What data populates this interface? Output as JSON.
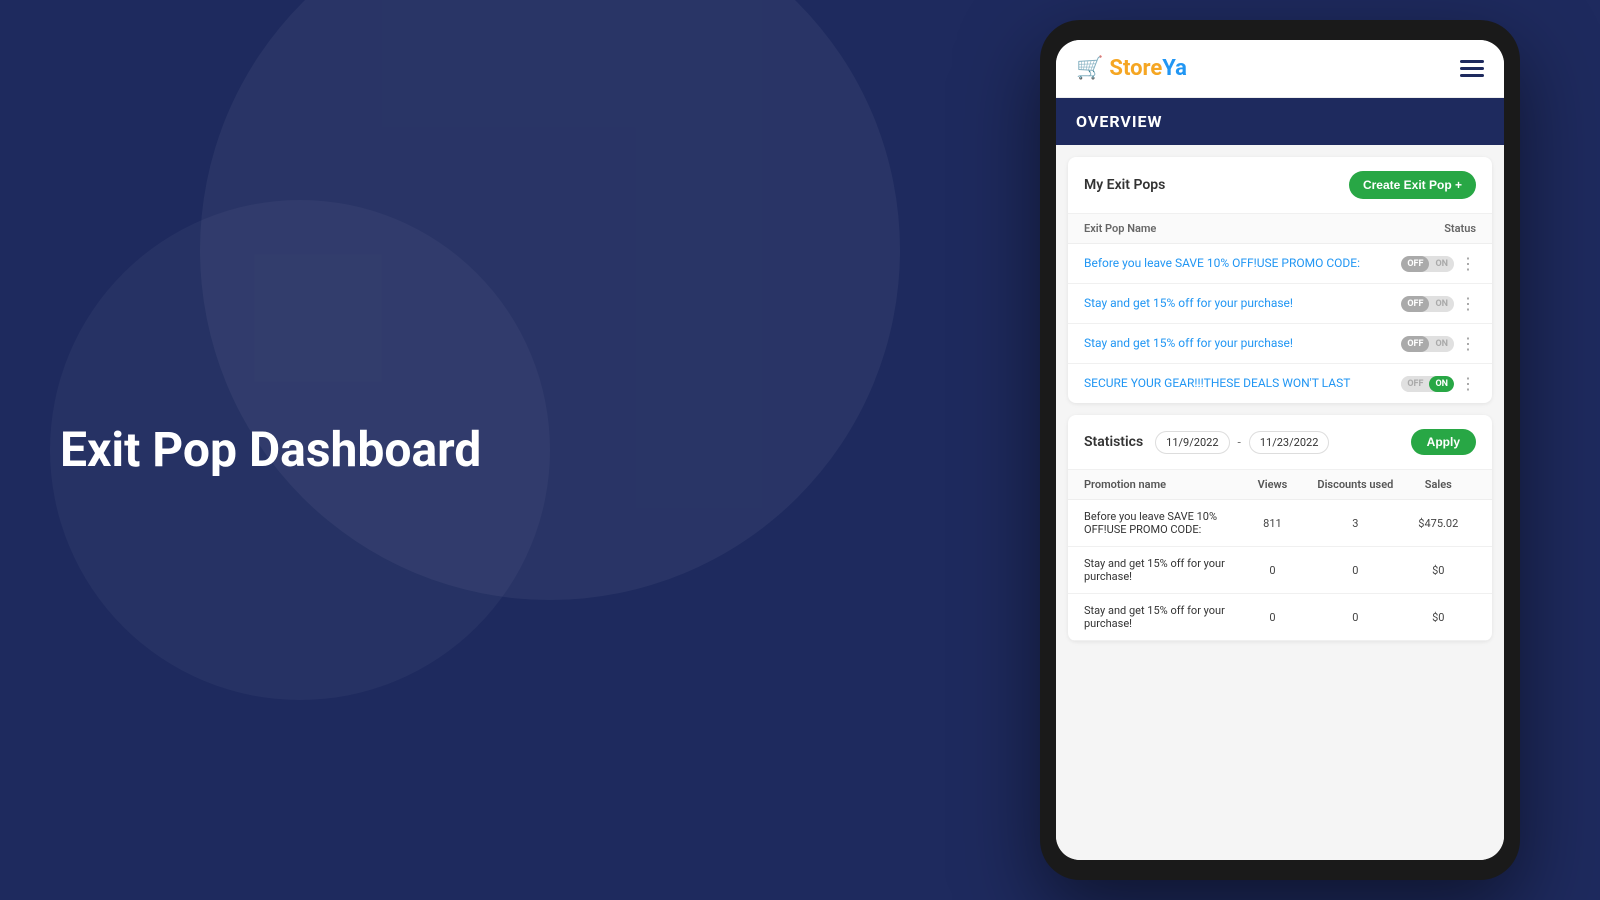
{
  "page": {
    "title": "Exit Pop Dashboard",
    "background": "#1e2a5e"
  },
  "app": {
    "logo_text": "StoreYa",
    "menu_icon": "hamburger"
  },
  "overview": {
    "label": "OVERVIEW"
  },
  "my_exit_pops": {
    "title": "My Exit Pops",
    "create_button": "Create Exit Pop +",
    "col_name": "Exit Pop Name",
    "col_status": "Status",
    "items": [
      {
        "name": "Before you leave SAVE 10% OFF!USE PROMO CODE:",
        "status": "off"
      },
      {
        "name": "Stay and get 15% off for your purchase!",
        "status": "off"
      },
      {
        "name": "Stay and get 15% off for your purchase!",
        "status": "off"
      },
      {
        "name": "SECURE YOUR GEAR!!!THESE DEALS WON'T LAST",
        "status": "on"
      }
    ]
  },
  "statistics": {
    "title": "Statistics",
    "date_from": "11/9/2022",
    "date_separator": "-",
    "date_to": "11/23/2022",
    "apply_button": "Apply",
    "cols": [
      "Promotion name",
      "Views",
      "Discounts used",
      "Sales"
    ],
    "rows": [
      {
        "name": "Before you leave SAVE 10% OFF!USE PROMO CODE:",
        "views": "811",
        "discounts": "3",
        "sales": "$475.02"
      },
      {
        "name": "Stay and get 15% off for your purchase!",
        "views": "0",
        "discounts": "0",
        "sales": "$0"
      },
      {
        "name": "Stay and get 15% off for your purchase!",
        "views": "0",
        "discounts": "0",
        "sales": "$0"
      }
    ]
  }
}
